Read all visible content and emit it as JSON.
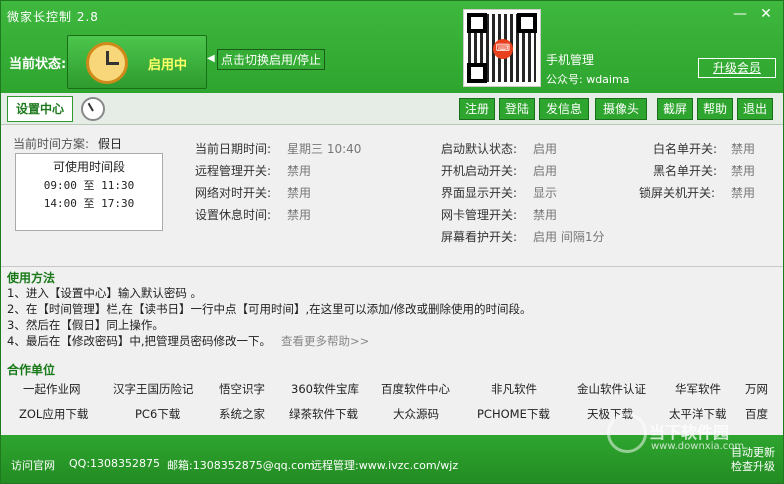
{
  "window": {
    "title": "微家长控制 2.8",
    "minimize": "—",
    "close": "✕"
  },
  "status": {
    "label": "当前状态:",
    "state": "启用中",
    "toggle_hint": "点击切换启用/停止"
  },
  "promo": {
    "mobile_title": "手机管理",
    "public_account": "公众号: wdaima",
    "upgrade": "升级会员"
  },
  "toolbar": {
    "settings_tab": "设置中心",
    "buttons": [
      "注册",
      "登陆",
      "发信息",
      "摄像头",
      "截屏",
      "帮助",
      "退出"
    ]
  },
  "panel": {
    "plan_label": "当前时间方案:",
    "plan_value": "假日",
    "period_title": "可使用时间段",
    "periods": [
      "09:00 至 11:30",
      "14:00 至 17:30"
    ],
    "col1": [
      {
        "label": "当前日期时间:",
        "value": "星期三   10:40"
      },
      {
        "label": "远程管理开关:",
        "value": "禁用"
      },
      {
        "label": "网络对时开关:",
        "value": "禁用"
      },
      {
        "label": "设置休息时间:",
        "value": "禁用"
      }
    ],
    "col2": [
      {
        "label": "启动默认状态:",
        "value": "启用"
      },
      {
        "label": "开机启动开关:",
        "value": "启用"
      },
      {
        "label": "界面显示开关:",
        "value": "显示"
      },
      {
        "label": "网卡管理开关:",
        "value": "禁用"
      },
      {
        "label": "屏幕看护开关:",
        "value": "启用  间隔1分"
      }
    ],
    "col3": [
      {
        "label": "白名单开关:",
        "value": "禁用"
      },
      {
        "label": "黑名单开关:",
        "value": "禁用"
      },
      {
        "label": "锁屏关机开关:",
        "value": "禁用"
      }
    ]
  },
  "usage": {
    "title": "使用方法",
    "lines": [
      "1、进入【设置中心】输入默认密码 。",
      "2、在【时间管理】栏,在【读书日】一行中点【可用时间】,在这里可以添加/修改或删除使用的时间段。",
      "3、然后在【假日】同上操作。",
      "4、最后在【修改密码】中,把管理员密码修改一下。"
    ],
    "more_help": "查看更多帮助>>"
  },
  "partners": {
    "title": "合作单位",
    "row1": [
      "一起作业网",
      "汉字王国历险记",
      "悟空识字",
      "360软件宝库",
      "百度软件中心",
      "非凡软件",
      "金山软件认证",
      "华军软件",
      "万网"
    ],
    "row2": [
      "ZOL应用下载",
      "PC6下载",
      "系统之家",
      "绿茶软件下载",
      "大众源码",
      "PCHOME下载",
      "天极下载",
      "太平洋下载",
      "百度"
    ]
  },
  "footer": {
    "official_site": "访问官网",
    "qq": "QQ:1308352875",
    "email": "邮箱:1308352875@qq.com",
    "remote": "远程管理:www.ivzc.com/wjz",
    "auto_update": "自动更新",
    "check_upgrade": "检查升级",
    "watermark": "当下软件园",
    "watermark_url": "www.downxia.com"
  },
  "colors": {
    "brand_green": "#2ea52e",
    "active_yellow": "#ffff66"
  },
  "icons": [
    "clock-icon",
    "qr-code-icon",
    "minimize-icon",
    "close-icon",
    "arrow-left-icon"
  ]
}
